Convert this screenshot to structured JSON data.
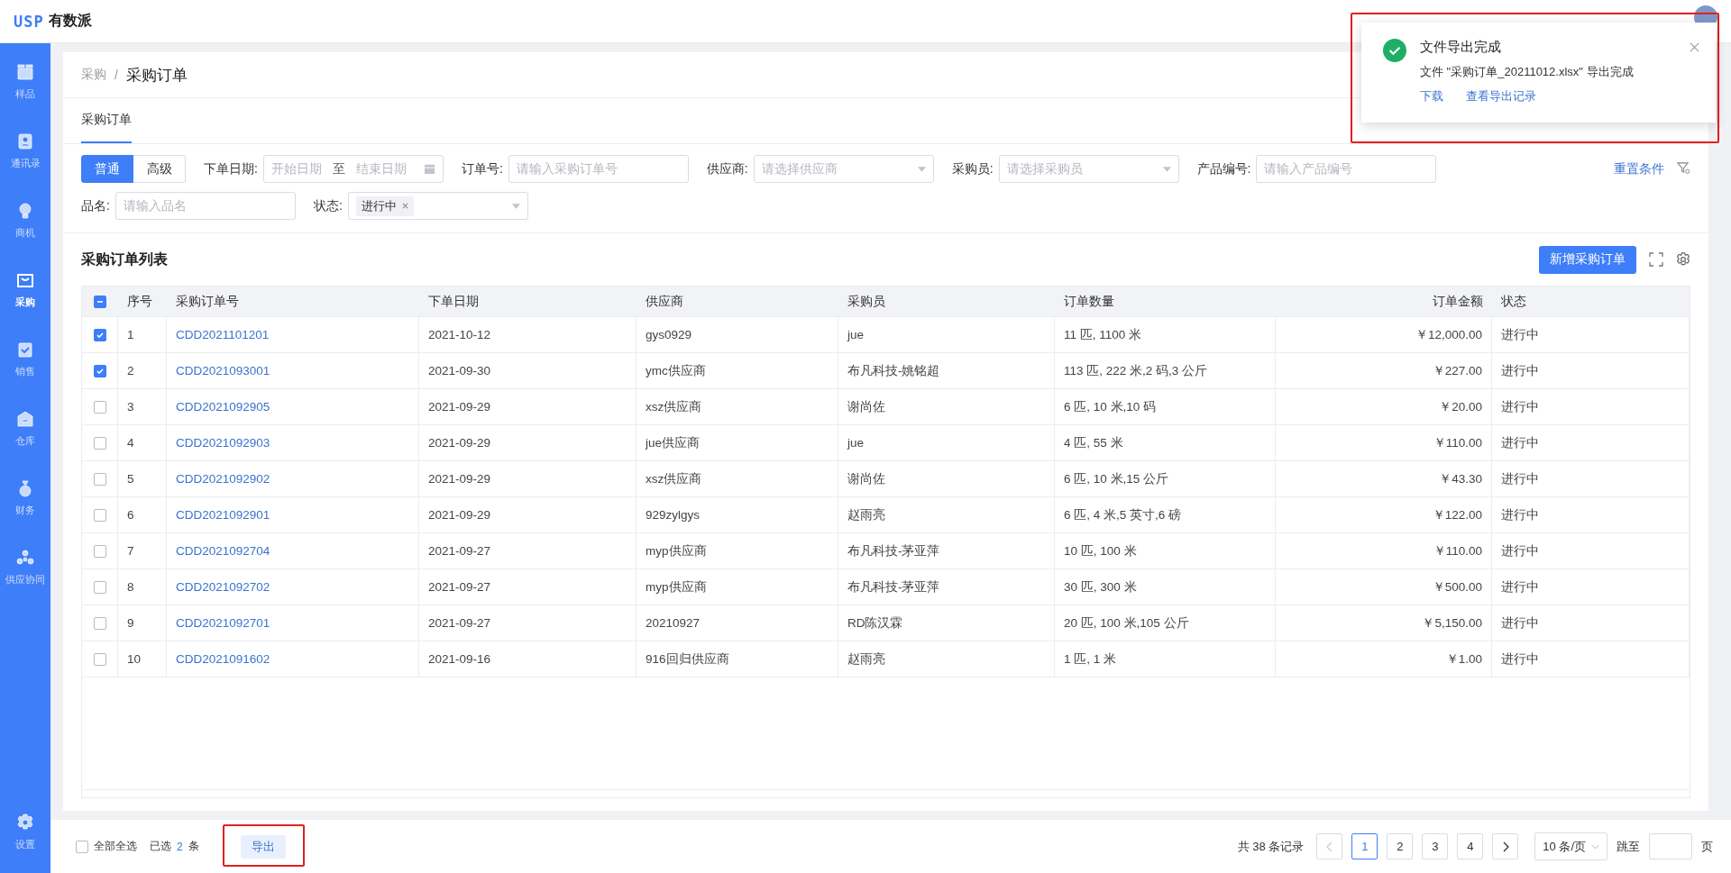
{
  "header": {
    "logo_mark": "USP",
    "logo_text": "有数派"
  },
  "sidebar": {
    "items": [
      {
        "label": "样品",
        "selected": false
      },
      {
        "label": "通讯录",
        "selected": false
      },
      {
        "label": "商机",
        "selected": false
      },
      {
        "label": "采购",
        "selected": true
      },
      {
        "label": "销售",
        "selected": false
      },
      {
        "label": "仓库",
        "selected": false
      },
      {
        "label": "财务",
        "selected": false
      },
      {
        "label": "供应协同",
        "selected": false
      }
    ],
    "settings_label": "设置"
  },
  "breadcrumb": {
    "parent": "采购",
    "separator": "/",
    "current": "采购订单"
  },
  "tabs": [
    {
      "label": "采购订单",
      "selected": true
    }
  ],
  "filters": {
    "modes": [
      {
        "label": "普通",
        "selected": true
      },
      {
        "label": "高级",
        "selected": false
      }
    ],
    "fields": [
      {
        "kind": "daterange",
        "label": "下单日期:",
        "start_placeholder": "开始日期",
        "separator": "至",
        "end_placeholder": "结束日期"
      },
      {
        "kind": "input",
        "label": "订单号:",
        "placeholder": "请输入采购订单号"
      },
      {
        "kind": "select",
        "label": "供应商:",
        "placeholder": "请选择供应商"
      },
      {
        "kind": "select",
        "label": "采购员:",
        "placeholder": "请选择采购员"
      },
      {
        "kind": "input",
        "label": "产品编号:",
        "placeholder": "请输入产品编号"
      },
      {
        "kind": "input",
        "label": "品名:",
        "placeholder": "请输入品名"
      },
      {
        "kind": "tagselect",
        "label": "状态:",
        "tags": [
          "进行中"
        ]
      }
    ],
    "reset_label": "重置条件"
  },
  "list": {
    "title": "采购订单列表",
    "add_button": "新增采购订单"
  },
  "table": {
    "header_checkbox": {
      "indeterminate": true
    },
    "columns": [
      "序号",
      "采购订单号",
      "下单日期",
      "供应商",
      "采购员",
      "订单数量",
      "订单金额",
      "状态"
    ],
    "rows": [
      {
        "checked": true,
        "cells": [
          "1",
          "CDD2021101201",
          "2021-10-12",
          "gys0929",
          "jue",
          "11 匹, 1100 米",
          "￥12,000.00",
          "进行中"
        ]
      },
      {
        "checked": true,
        "cells": [
          "2",
          "CDD2021093001",
          "2021-09-30",
          "ymc供应商",
          "布凡科技-姚铭超",
          "113 匹, 222 米,2 码,3 公斤",
          "￥227.00",
          "进行中"
        ]
      },
      {
        "checked": false,
        "cells": [
          "3",
          "CDD2021092905",
          "2021-09-29",
          "xsz供应商",
          "谢尚佐",
          "6 匹, 10 米,10 码",
          "￥20.00",
          "进行中"
        ]
      },
      {
        "checked": false,
        "cells": [
          "4",
          "CDD2021092903",
          "2021-09-29",
          "jue供应商",
          "jue",
          "4 匹, 55 米",
          "￥110.00",
          "进行中"
        ]
      },
      {
        "checked": false,
        "cells": [
          "5",
          "CDD2021092902",
          "2021-09-29",
          "xsz供应商",
          "谢尚佐",
          "6 匹, 10 米,15 公斤",
          "￥43.30",
          "进行中"
        ]
      },
      {
        "checked": false,
        "cells": [
          "6",
          "CDD2021092901",
          "2021-09-29",
          "929zylgys",
          "赵雨亮",
          "6 匹, 4 米,5 英寸,6 磅",
          "￥122.00",
          "进行中"
        ]
      },
      {
        "checked": false,
        "cells": [
          "7",
          "CDD2021092704",
          "2021-09-27",
          "myp供应商",
          "布凡科技-茅亚萍",
          "10 匹, 100 米",
          "￥110.00",
          "进行中"
        ]
      },
      {
        "checked": false,
        "cells": [
          "8",
          "CDD2021092702",
          "2021-09-27",
          "myp供应商",
          "布凡科技-茅亚萍",
          "30 匹, 300 米",
          "￥500.00",
          "进行中"
        ]
      },
      {
        "checked": false,
        "cells": [
          "9",
          "CDD2021092701",
          "2021-09-27",
          "20210927",
          "RD陈汉霖",
          "20 匹, 100 米,105 公斤",
          "￥5,150.00",
          "进行中"
        ]
      },
      {
        "checked": false,
        "cells": [
          "10",
          "CDD2021091602",
          "2021-09-16",
          "916回归供应商",
          "赵雨亮",
          "1 匹, 1 米",
          "￥1.00",
          "进行中"
        ]
      }
    ]
  },
  "footer": {
    "select_all": {
      "label": "全部全选",
      "checked": false
    },
    "selected_label": "已选",
    "selected_count": "2",
    "selected_unit": "条",
    "export_button": "导出"
  },
  "pagination": {
    "total": "共 38 条记录",
    "prev_disabled": true,
    "pages": [
      {
        "label": "1",
        "selected": true
      },
      {
        "label": "2",
        "selected": false
      },
      {
        "label": "3",
        "selected": false
      },
      {
        "label": "4",
        "selected": false
      }
    ],
    "page_size": "10 条/页",
    "jump_label": "跳至",
    "jump_unit": "页"
  },
  "toast": {
    "title": "文件导出完成",
    "message": "文件 \"采购订单_20211012.xlsx\" 导出完成",
    "links": [
      "下载",
      "查看导出记录"
    ]
  }
}
